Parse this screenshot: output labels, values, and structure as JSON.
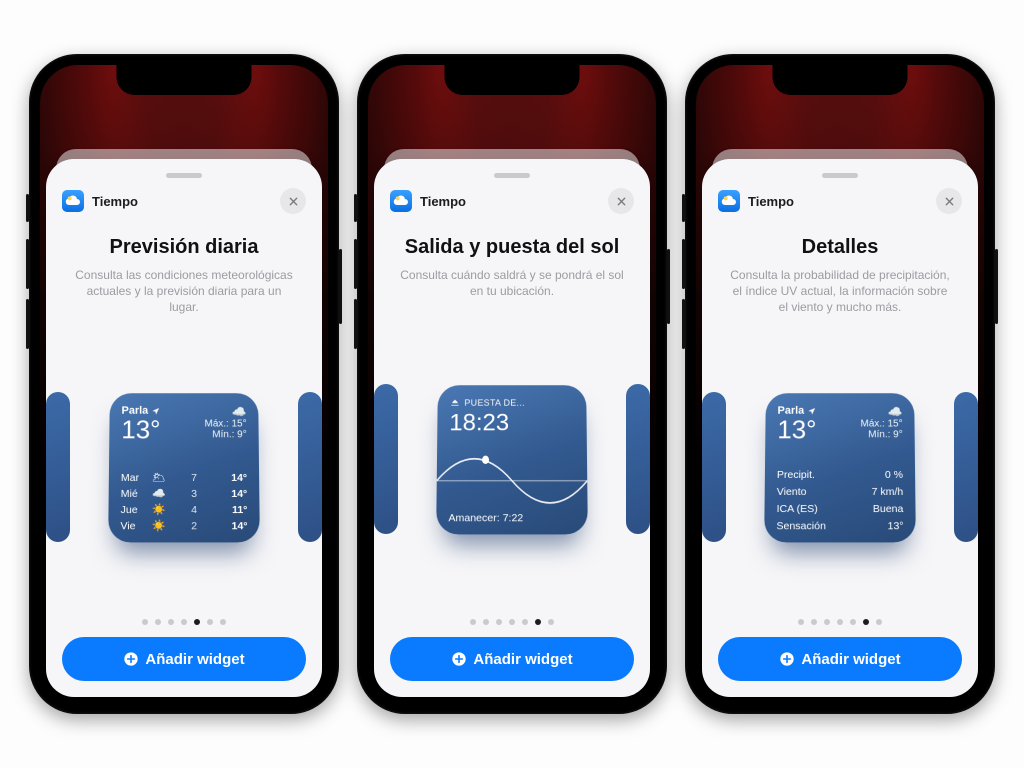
{
  "app_name": "Tiempo",
  "add_button_label": "Añadir widget",
  "page_dots": {
    "total": 7
  },
  "phones": [
    {
      "title": "Previsión diaria",
      "desc": "Consulta las condiciones meteorológicas actuales y la previsión diaria para un lugar.",
      "active_dot": 4,
      "peek_left": true,
      "peek_right": true,
      "widget": {
        "kind": "daily",
        "location": "Parla",
        "temp": "13°",
        "cond_icon": "cloud",
        "high": "Máx.: 15°",
        "low": "Mín.: 9°",
        "days": [
          {
            "name": "Mar",
            "icon": "🌥",
            "lo": "7",
            "hi": "14°"
          },
          {
            "name": "Mié",
            "icon": "☁️",
            "lo": "3",
            "hi": "14°"
          },
          {
            "name": "Jue",
            "icon": "☀️",
            "lo": "4",
            "hi": "11°"
          },
          {
            "name": "Vie",
            "icon": "☀️",
            "lo": "2",
            "hi": "14°"
          }
        ]
      }
    },
    {
      "title": "Salida y puesta del sol",
      "desc": "Consulta cuándo saldrá y se pondrá el sol en tu ubicación.",
      "active_dot": 5,
      "peek_left": true,
      "peek_right": true,
      "widget": {
        "kind": "sun",
        "label": "PUESTA DE...",
        "time": "18:23",
        "sunrise": "Amanecer: 7:22"
      }
    },
    {
      "title": "Detalles",
      "desc": "Consulta la probabilidad de precipitación, el índice UV actual, la información sobre el viento y mucho más.",
      "active_dot": 5,
      "peek_left": true,
      "peek_right": true,
      "widget": {
        "kind": "details",
        "location": "Parla",
        "temp": "13°",
        "cond_icon": "cloud",
        "high": "Máx.: 15°",
        "low": "Mín.: 9°",
        "rows": [
          {
            "k": "Precipit.",
            "v": "0 %"
          },
          {
            "k": "Viento",
            "v": "7 km/h"
          },
          {
            "k": "ICA (ES)",
            "v": "Buena"
          },
          {
            "k": "Sensación",
            "v": "13°"
          }
        ]
      }
    }
  ]
}
